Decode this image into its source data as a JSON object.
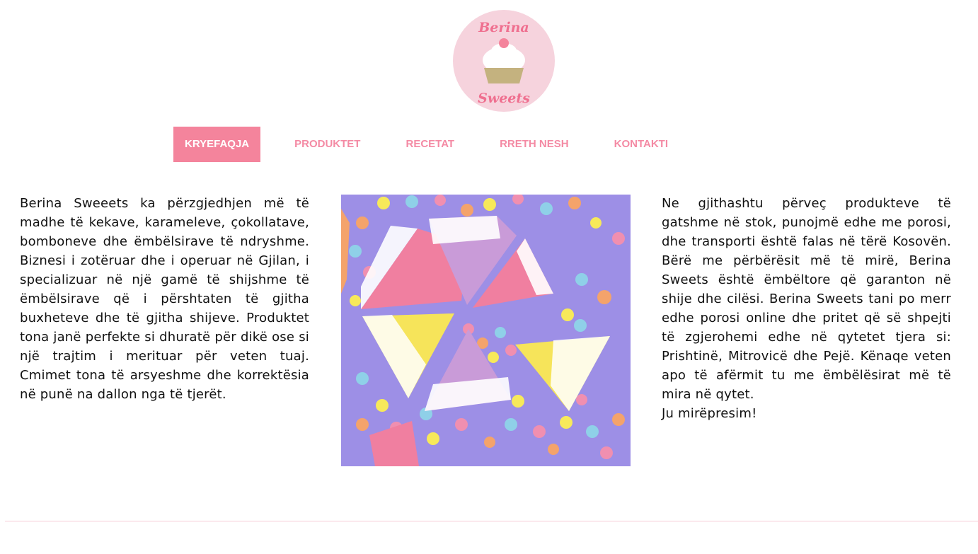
{
  "brand": {
    "logo_text_top": "Berina",
    "logo_text_bottom": "Sweets",
    "colors": {
      "accent": "#f4849c",
      "logo_circle": "#f6d3dd",
      "logo_text": "#ef6f8f",
      "cupcake_base": "#c4b27f"
    }
  },
  "nav": {
    "items": [
      {
        "label": "KRYEFAQJA",
        "active": true
      },
      {
        "label": "PRODUKTET",
        "active": false
      },
      {
        "label": "RECETAT",
        "active": false
      },
      {
        "label": "RRETH NESH",
        "active": false
      },
      {
        "label": "KONTAKTI",
        "active": false
      }
    ]
  },
  "content": {
    "left_text": "Berina Sweeets ka përzgjedhjen më të madhe të kekave, karameleve, çokollatave, bomboneve dhe ëmbëlsirave të ndryshme. Biznesi i zotëruar dhe i operuar në Gjilan, i specializuar në një gamë të shijshme të ëmbëlsirave që i përshtaten të gjitha buxheteve dhe të gjitha shijeve. Produktet tona janë perfekte si dhuratë për dikë ose si një trajtim i merituar për veten tuaj. Cmimet tona të arsyeshme dhe korrektësia në punë na dallon nga të tjerët.",
    "right_text": "Ne gjithashtu përveç produkteve të gatshme në stok, punojmë edhe me porosi, dhe transporti është falas në tërë Kosovën. Bërë me përbërësit më të mirë, Berina Sweets është ëmbëltore që garanton në shije dhe cilësi. Berina Sweets tani po merr edhe porosi online dhe pritet që së shpejti të zgjerohemi edhe në qytetet tjera si: Prishtinë, Mitrovicë dhe Pejë. Kënaqe veten apo të afërmit tu me ëmbëlësirat më të mira në qytet.",
    "right_closing": "Ju mirëpresim!",
    "photo_icon": "candy-photo"
  }
}
